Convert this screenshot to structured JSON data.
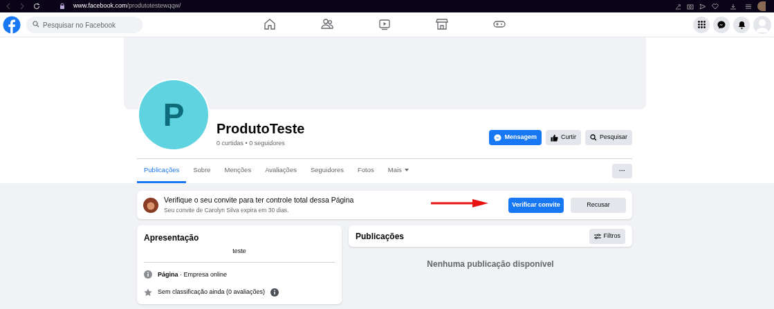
{
  "browser": {
    "url_host": "www.facebook.com",
    "url_path": "/produtotestewqqw/"
  },
  "header": {
    "search": {
      "placeholder": "Pesquisar no Facebook"
    }
  },
  "page": {
    "initial": "P",
    "name": "ProdutoTeste",
    "stats": "0 curtidas • 0 seguidores",
    "actions": [
      {
        "label": "Mensagem",
        "kind": "message"
      },
      {
        "label": "Curtir",
        "kind": "like"
      },
      {
        "label": "Pesquisar",
        "kind": "search"
      }
    ],
    "tabs": [
      {
        "label": "Publicações",
        "selected": true
      },
      {
        "label": "Sobre",
        "selected": false
      },
      {
        "label": "Menções",
        "selected": false
      },
      {
        "label": "Avaliações",
        "selected": false
      },
      {
        "label": "Seguidores",
        "selected": false
      },
      {
        "label": "Fotos",
        "selected": false
      },
      {
        "label": "Mais",
        "selected": false,
        "dropdown": true
      }
    ],
    "more_button": "···"
  },
  "invite": {
    "title": "Verifique o seu convite para ter controle total dessa Página",
    "subtitle": "Seu convite de Carolyn Silva expira em 30 dias.",
    "accept": "Verificar convite",
    "decline": "Recusar"
  },
  "intro": {
    "title": "Apresentação",
    "description": "teste",
    "items": [
      {
        "kind": "info",
        "text": "**Página** · Empresa online"
      },
      {
        "kind": "rating",
        "text": "Sem classificação ainda (0 avaliações)"
      }
    ]
  },
  "posts": {
    "title": "Publicações",
    "filter": "Filtros",
    "empty": "Nenhuma publicação disponível"
  }
}
